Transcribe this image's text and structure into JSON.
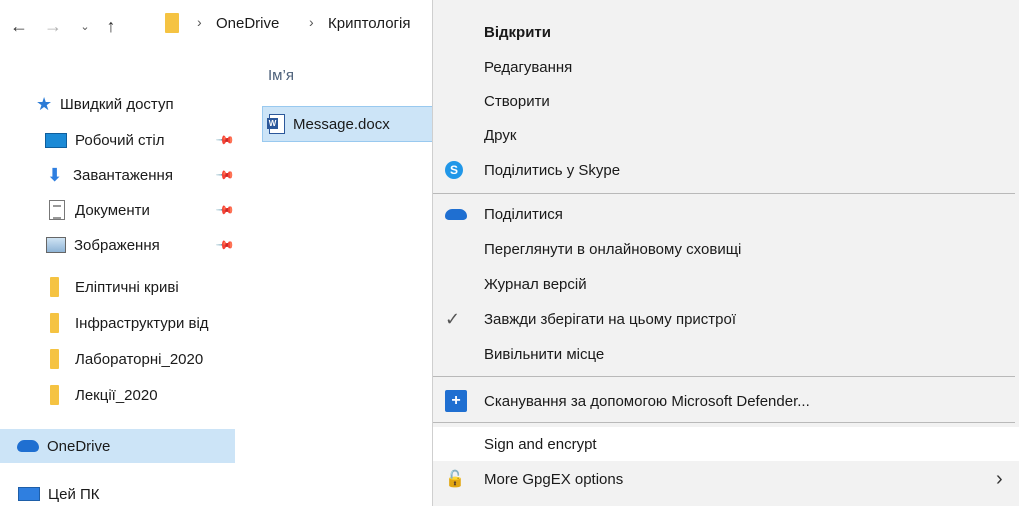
{
  "address_bar": {
    "back_icon": "←",
    "forward_icon": "→",
    "recent_icon": "⌄",
    "up_icon": "↑",
    "sep1": "›",
    "crumb1": "OneDrive",
    "sep2": "›",
    "crumb2": "Криптологія"
  },
  "sidebar": {
    "quick_access": "Швидкий доступ",
    "items": [
      {
        "label": "Робочий стіл",
        "pinned": true
      },
      {
        "label": "Завантаження",
        "pinned": true
      },
      {
        "label": "Документи",
        "pinned": true
      },
      {
        "label": "Зображення",
        "pinned": true
      },
      {
        "label": "Еліптичні криві",
        "pinned": false
      },
      {
        "label": "Інфраструктури від",
        "pinned": false
      },
      {
        "label": "Лабораторні_2020",
        "pinned": false
      },
      {
        "label": "Лекції_2020",
        "pinned": false
      }
    ],
    "onedrive": "OneDrive",
    "this_pc": "Цей ПК"
  },
  "file_list": {
    "column_name": "Ім’я",
    "files": [
      {
        "name": "Message.docx",
        "type": "word-document"
      }
    ]
  },
  "context_menu": {
    "items": [
      {
        "label": "Відкрити",
        "bold": true,
        "icon": null
      },
      {
        "label": "Редагування",
        "icon": null
      },
      {
        "label": "Створити",
        "icon": null
      },
      {
        "label": "Друк",
        "icon": null
      },
      {
        "label": "Поділитись у Skype",
        "icon": "skype-icon"
      },
      {
        "label": "Поділитися",
        "icon": "onedrive-cloud-icon"
      },
      {
        "label": "Переглянути в онлайновому сховищі",
        "icon": null
      },
      {
        "label": "Журнал версій",
        "icon": null
      },
      {
        "label": "Завжди зберігати на цьому пристрої",
        "icon": "checkmark-icon"
      },
      {
        "label": "Вивільнити місце",
        "icon": null
      },
      {
        "label": "Сканування за допомогою Microsoft Defender...",
        "icon": "defender-shield-icon"
      },
      {
        "label": "Sign and encrypt",
        "icon": null
      },
      {
        "label": "More GpgEX options",
        "icon": "lock-icon",
        "submenu": true
      }
    ],
    "skype_glyph": "S",
    "check_glyph": "✓",
    "shield_glyph": "+",
    "lock_glyph": "🔓",
    "submenu_arrow": "›"
  },
  "colors": {
    "selection": "#cce4f7",
    "menu_background": "#f2f2f2",
    "accent_blue": "#1f6fd1",
    "folder_yellow": "#f5c342"
  }
}
